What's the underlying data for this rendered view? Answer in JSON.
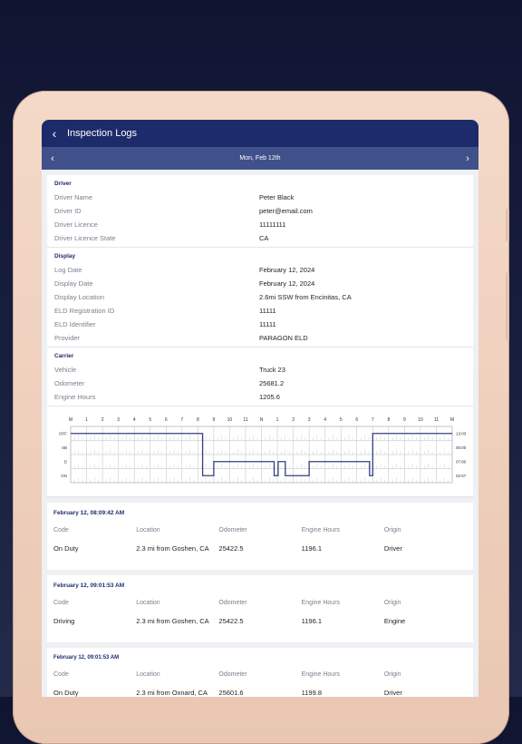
{
  "header": {
    "title": "Inspection Logs",
    "back_icon": "chevron-left-icon"
  },
  "datebar": {
    "date": "Mon, Feb 12th"
  },
  "sections": {
    "driver": {
      "title": "Driver",
      "rows": [
        {
          "label": "Driver Name",
          "value": "Peter Black"
        },
        {
          "label": "Driver ID",
          "value": "peter@email.com"
        },
        {
          "label": "Driver Licence",
          "value": "11111111"
        },
        {
          "label": "Driver Licence State",
          "value": "CA"
        }
      ]
    },
    "display": {
      "title": "Display",
      "rows": [
        {
          "label": "Log Date",
          "value": "February 12, 2024"
        },
        {
          "label": "Display Date",
          "value": "February 12, 2024"
        },
        {
          "label": "Display Location",
          "value": "2.6mi SSW from Encinitas, CA"
        },
        {
          "label": "ELD Registration ID",
          "value": "11111"
        },
        {
          "label": "ELD Identifier",
          "value": "11111"
        },
        {
          "label": "Provider",
          "value": "PARAGON ELD"
        }
      ]
    },
    "carrier": {
      "title": "Carrier",
      "rows": [
        {
          "label": "Vehicle",
          "value": "Truck 23"
        },
        {
          "label": "Odometer",
          "value": "25681.2"
        },
        {
          "label": "Engine Hours",
          "value": "1205.6"
        }
      ]
    }
  },
  "graph": {
    "hours": [
      "M",
      "1",
      "2",
      "3",
      "4",
      "5",
      "6",
      "7",
      "8",
      "9",
      "10",
      "11",
      "N",
      "1",
      "2",
      "3",
      "4",
      "5",
      "6",
      "7",
      "8",
      "9",
      "10",
      "11",
      "M"
    ],
    "statuses": [
      "OFF",
      "SB",
      "D",
      "ON"
    ],
    "totals": [
      "13:03",
      "00:00",
      "07:80",
      "02:67"
    ],
    "line_color": "#33407a",
    "segments": [
      {
        "status": 0,
        "start": 0,
        "end": 8.3
      },
      {
        "status": 3,
        "start": 8.3,
        "end": 9.0
      },
      {
        "status": 2,
        "start": 9.0,
        "end": 12.8
      },
      {
        "status": 3,
        "start": 12.8,
        "end": 13.05
      },
      {
        "status": 2,
        "start": 13.05,
        "end": 13.5
      },
      {
        "status": 3,
        "start": 13.5,
        "end": 15.0
      },
      {
        "status": 2,
        "start": 15.0,
        "end": 18.8
      },
      {
        "status": 3,
        "start": 18.8,
        "end": 19.0
      },
      {
        "status": 0,
        "start": 19.0,
        "end": 24
      }
    ]
  },
  "log_columns": [
    "Code",
    "Location",
    "Odometer",
    "Engine Hours",
    "Origin"
  ],
  "logs": [
    {
      "timestamp": "February 12, 08:09:42 AM",
      "values": [
        "On Duty",
        "2.3 mi from Goshen, CA",
        "25422.5",
        "1196.1",
        "Driver"
      ]
    },
    {
      "timestamp": "February 12, 09:01:53 AM",
      "values": [
        "Driving",
        "2.3 mi from Goshen, CA",
        "25422.5",
        "1196.1",
        "Engine"
      ]
    },
    {
      "timestamp": "February 12, 09:01:53 AM",
      "values": [
        "On Duty",
        "2.3 mi from Oxnard, CA",
        "25601.6",
        "1199.8",
        "Driver"
      ]
    }
  ]
}
